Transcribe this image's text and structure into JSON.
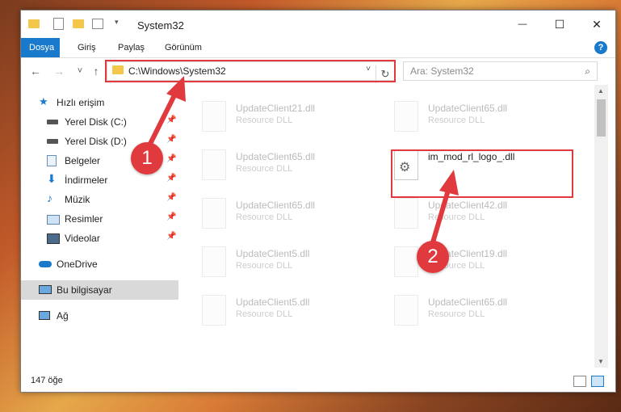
{
  "window": {
    "title": "System32",
    "minimize_symbol": "—",
    "maximize_symbol": "☐",
    "close_symbol": "✕"
  },
  "ribbon": {
    "tabs": [
      "Dosya",
      "Giriş",
      "Paylaş",
      "Görünüm"
    ],
    "help_symbol": "?"
  },
  "nav": {
    "back": "←",
    "forward": "→",
    "recent": "˅",
    "up": "↑",
    "address": "C:\\Windows\\System32",
    "address_dropdown": "˅",
    "refresh": "↻",
    "search_placeholder": "Ara: System32",
    "search_icon": "⌕"
  },
  "sidebar": {
    "items": [
      {
        "label": "Hızlı erişim",
        "icon": "star-icon",
        "pinned": false
      },
      {
        "label": "Yerel Disk (C:)",
        "icon": "drive-icon",
        "pinned": true
      },
      {
        "label": "Yerel Disk (D:)",
        "icon": "drive-icon",
        "pinned": true
      },
      {
        "label": "Belgeler",
        "icon": "documents-icon",
        "pinned": true
      },
      {
        "label": "İndirmeler",
        "icon": "download-icon",
        "pinned": true
      },
      {
        "label": "Müzik",
        "icon": "music-icon",
        "pinned": true
      },
      {
        "label": "Resimler",
        "icon": "pictures-icon",
        "pinned": true
      },
      {
        "label": "Videolar",
        "icon": "videos-icon",
        "pinned": true
      },
      {
        "label": "OneDrive",
        "icon": "cloud-icon",
        "pinned": false
      },
      {
        "label": "Bu bilgisayar",
        "icon": "computer-icon",
        "pinned": false
      },
      {
        "label": "Ağ",
        "icon": "network-icon",
        "pinned": false
      }
    ],
    "pin_symbol": "📌"
  },
  "files": [
    {
      "name": "UpdateClient21.dll",
      "type": "Resource DLL"
    },
    {
      "name": "UpdateClient65.dll",
      "type": "Resource DLL"
    },
    {
      "name": "UpdateClient65.dll",
      "type": "Resource DLL"
    },
    {
      "name": "im_mod_rl_logo_.dll",
      "type": ""
    },
    {
      "name": "UpdateClient65.dll",
      "type": "Resource DLL"
    },
    {
      "name": "UpdateClient42.dll",
      "type": "Resource DLL"
    },
    {
      "name": "UpdateClient5.dll",
      "type": "Resource DLL"
    },
    {
      "name": "UpdateClient19.dll",
      "type": "Resource DLL"
    },
    {
      "name": "UpdateClient5.dll",
      "type": "Resource DLL"
    },
    {
      "name": "UpdateClient65.dll",
      "type": "Resource DLL"
    }
  ],
  "status": {
    "count": "147 öğe"
  },
  "markers": [
    "1",
    "2"
  ],
  "colors": {
    "accent": "#1979ca",
    "annotation_red": "#e0393e"
  }
}
